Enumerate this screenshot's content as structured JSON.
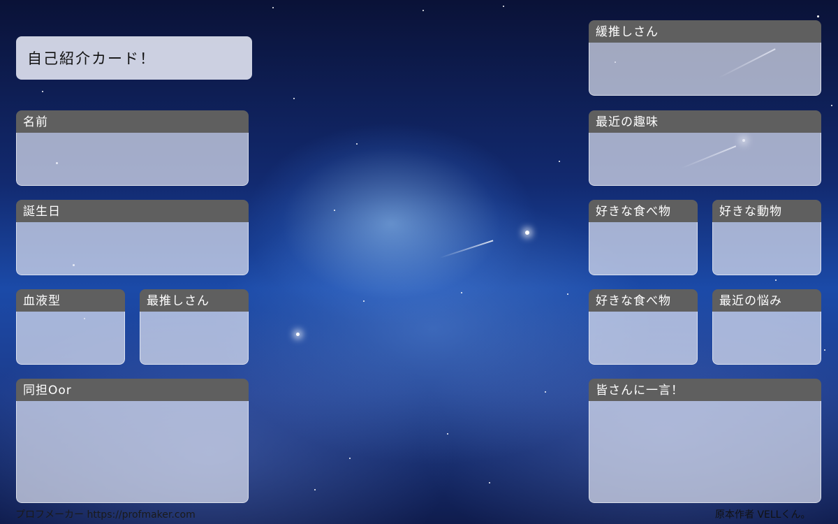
{
  "title": "自己紹介カード！",
  "fields": {
    "name": "名前",
    "birthday": "誕生日",
    "blood_type": "血液型",
    "oshi": "最推しさん",
    "doutan": "同担Oor",
    "secondary_oshi": "緩推しさん",
    "recent_hobby": "最近の趣味",
    "fav_food_1": "好きな食べ物",
    "fav_animal": "好きな動物",
    "fav_food_2": "好きな食べ物",
    "recent_worry": "最近の悩み",
    "message": "皆さんに一言！"
  },
  "footer": {
    "maker": "プロフメーカー https://profmaker.com",
    "credit": "原本作者 VELLくん。"
  }
}
